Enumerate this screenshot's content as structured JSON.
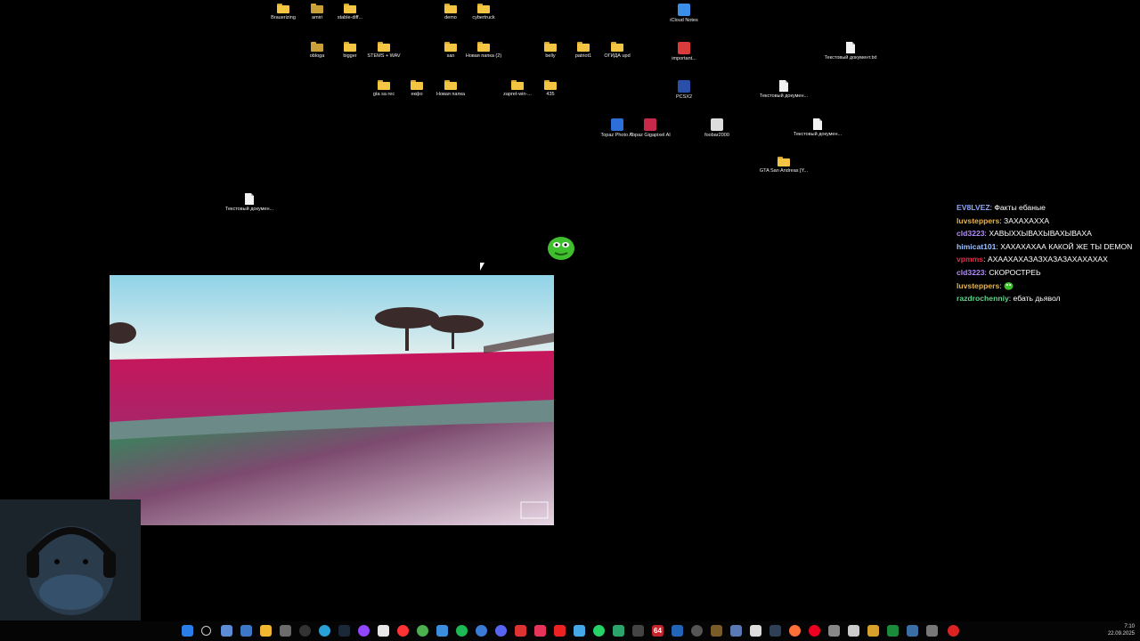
{
  "desktop": {
    "icons": [
      {
        "label": "Brauerizing",
        "type": "folder"
      },
      {
        "label": "amiri",
        "type": "folder-dark"
      },
      {
        "label": "stable-diff...",
        "type": "folder"
      },
      {
        "label": "demo",
        "type": "folder"
      },
      {
        "label": "cybertruck",
        "type": "folder"
      },
      {
        "label": "iCloud Notes",
        "type": "app"
      },
      {
        "label": "obloga",
        "type": "folder-dark"
      },
      {
        "label": "bigger",
        "type": "folder"
      },
      {
        "label": "STEMS + WAV",
        "type": "folder"
      },
      {
        "label": "san",
        "type": "folder"
      },
      {
        "label": "Новая папка (2)",
        "type": "folder"
      },
      {
        "label": "belly",
        "type": "folder"
      },
      {
        "label": "patriot1",
        "type": "folder"
      },
      {
        "label": "ОГИДА upd",
        "type": "folder"
      },
      {
        "label": "important...",
        "type": "app"
      },
      {
        "label": "Текстовый документ.txt",
        "type": "file"
      },
      {
        "label": "gta sa rec",
        "type": "folder"
      },
      {
        "label": "екфо",
        "type": "folder"
      },
      {
        "label": "Новая папка",
        "type": "folder"
      },
      {
        "label": "zapret-win-...",
        "type": "folder"
      },
      {
        "label": "435",
        "type": "folder"
      },
      {
        "label": "PCSX2",
        "type": "app"
      },
      {
        "label": "Текстовый докумен...",
        "type": "file"
      },
      {
        "label": "Topaz Photo AI",
        "type": "app"
      },
      {
        "label": "Topaz Gigapixel AI",
        "type": "app"
      },
      {
        "label": "foobar2000",
        "type": "app"
      },
      {
        "label": "Текстовый докумен...",
        "type": "file"
      },
      {
        "label": "GTA San Andreas [Y...",
        "type": "folder"
      },
      {
        "label": "Текстовый докумен...",
        "type": "file"
      }
    ]
  },
  "chat": {
    "messages": [
      {
        "user": "EV8LVEZ",
        "text": "Факты ебаные",
        "color": "#8fa8ff"
      },
      {
        "user": "luvsteppers",
        "text": "ЗАХАХАХХА",
        "color": "#e8b44c"
      },
      {
        "user": "cld3223",
        "text": "ХАВЫХХЫВАХЫВАХЫВАХА",
        "color": "#b38bff"
      },
      {
        "user": "himicat101",
        "text": "ХАХАХАХАА КАКОЙ ЖЕ ТЫ DEMON",
        "color": "#9fc2ff"
      },
      {
        "user": "vpmms",
        "text": "АХААХАХАЗАЗХАЗАЗАХАХАХАХ",
        "color": "#e0304a"
      },
      {
        "user": "cld3223",
        "text": "СКОРОСТРЕЬ",
        "color": "#b38bff"
      },
      {
        "user": "luvsteppers",
        "text": "",
        "color": "#e8b44c",
        "emote": "pepe"
      },
      {
        "user": "razdrochenniy",
        "text": "ебать дьявол",
        "color": "#5fd48a"
      }
    ]
  },
  "taskbar": {
    "time": "7:10",
    "date": "22.09.2025",
    "icons": [
      "windows-start-icon",
      "search-icon",
      "task-view-icon",
      "widgets-icon",
      "file-explorer-icon",
      "terminal-icon",
      "obs-icon",
      "telegram-icon",
      "steam-icon",
      "twitch-icon",
      "calendar-icon",
      "yandex-browser-icon",
      "chrome-icon",
      "mail-icon",
      "spotify-icon",
      "network-icon",
      "discord-icon",
      "media-icon",
      "music-icon",
      "brave-icon",
      "icloud-icon",
      "whatsapp-icon",
      "game-icon",
      "console-icon",
      "counter-icon",
      "vscode-icon",
      "clock-icon",
      "nvidia-icon",
      "vpn-icon",
      "unity-icon",
      "grid-icon",
      "firefox-icon",
      "opera-icon",
      "settings-icon",
      "notepad-icon",
      "excel-icon",
      "snipping-icon",
      "sandbox-icon",
      "screen-icon"
    ],
    "counter_badge": "64"
  },
  "colors": {
    "desktop_bg": "#000000",
    "taskbar_bg": "#050505"
  }
}
